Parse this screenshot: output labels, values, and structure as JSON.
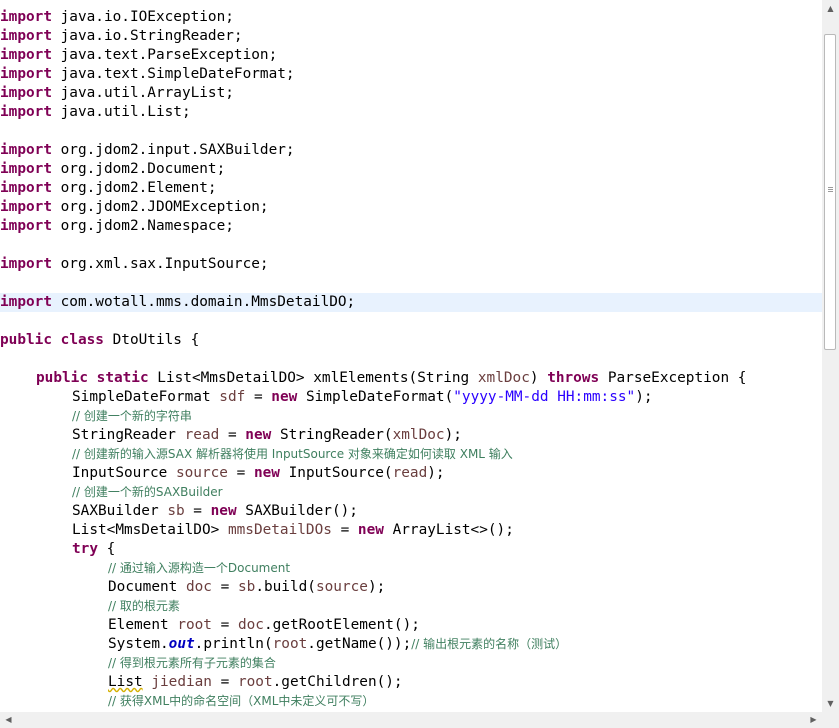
{
  "code": {
    "imports": [
      {
        "keyword": "import",
        "path": " java.io.IOException;"
      },
      {
        "keyword": "import",
        "path": " java.io.StringReader;"
      },
      {
        "keyword": "import",
        "path": " java.text.ParseException;"
      },
      {
        "keyword": "import",
        "path": " java.text.SimpleDateFormat;"
      },
      {
        "keyword": "import",
        "path": " java.util.ArrayList;"
      },
      {
        "keyword": "import",
        "path": " java.util.List;"
      },
      {
        "keyword": "import",
        "path": " org.jdom2.input.SAXBuilder;"
      },
      {
        "keyword": "import",
        "path": " org.jdom2.Document;"
      },
      {
        "keyword": "import",
        "path": " org.jdom2.Element;"
      },
      {
        "keyword": "import",
        "path": " org.jdom2.JDOMException;"
      },
      {
        "keyword": "import",
        "path": " org.jdom2.Namespace;"
      },
      {
        "keyword": "import",
        "path": " org.xml.sax.InputSource;"
      },
      {
        "keyword": "import",
        "path": " com.wotall.mms.domain.MmsDetailDO;"
      }
    ],
    "class_decl": {
      "kw1": "public",
      "kw2": "class",
      "name": " DtoUtils {"
    },
    "method_decl": {
      "kw1": "public",
      "kw2": "static",
      "before_param": " List<MmsDetailDO> xmlElements(String ",
      "param": "xmlDoc",
      "after_param": ") ",
      "kw3": "throws",
      "tail": " ParseException {"
    },
    "l_sdf": {
      "type": "SimpleDateFormat ",
      "var": "sdf",
      "eq": " = ",
      "kw": "new",
      "ctor": " SimpleDateFormat(",
      "str": "\"yyyy-MM-dd HH:mm:ss\"",
      "end": ");"
    },
    "c1": "// 创建一个新的字符串",
    "l_read": {
      "type": "StringReader ",
      "var": "read",
      "eq": " = ",
      "kw": "new",
      "ctor": " StringReader(",
      "arg": "xmlDoc",
      "end": ");"
    },
    "c2": "// 创建新的输入源SAX 解析器将使用 InputSource 对象来确定如何读取 XML 输入",
    "l_source": {
      "type": "InputSource ",
      "var": "source",
      "eq": " = ",
      "kw": "new",
      "ctor": " InputSource(",
      "arg": "read",
      "end": ");"
    },
    "c3": "// 创建一个新的SAXBuilder",
    "l_sb": {
      "type": "SAXBuilder ",
      "var": "sb",
      "eq": " = ",
      "kw": "new",
      "ctor": " SAXBuilder();"
    },
    "l_list": {
      "type": "List<MmsDetailDO> ",
      "var": "mmsDetailDOs",
      "eq": " = ",
      "kw": "new",
      "ctor": " ArrayList<>();"
    },
    "l_try": {
      "kw": "try",
      "end": " {"
    },
    "c4": "// 通过输入源构造一个Document",
    "l_doc": {
      "type": "Document ",
      "var": "doc",
      "eq": " = ",
      "obj": "sb",
      "call": ".build(",
      "arg": "source",
      "end": ");"
    },
    "c5": "// 取的根元素",
    "l_root": {
      "type": "Element ",
      "var": "root",
      "eq": " = ",
      "obj": "doc",
      "call": ".getRootElement();"
    },
    "l_print": {
      "cls": "System.",
      "field": "out",
      "call": ".println(",
      "obj": "root",
      "call2": ".getName());",
      "comment": "// 输出根元素的名称（测试）"
    },
    "c6": "// 得到根元素所有子元素的集合",
    "l_children": {
      "type": "List",
      "sp": " ",
      "var": "jiedian",
      "eq": " = ",
      "obj": "root",
      "call": ".getChildren();"
    },
    "c7": "// 获得XML中的命名空间（XML中未定义可不写）"
  },
  "colors": {
    "keyword": "#7f0055",
    "local_var": "#6a3e3e",
    "string": "#2a00ff",
    "comment": "#3f7f5f",
    "static_field": "#0000c0",
    "current_line": "#e8f2fe"
  },
  "scrollbars": {
    "up_icon": "▲",
    "down_icon": "▼",
    "left_icon": "◀",
    "right_icon": "▶",
    "grip_icon": "≡"
  }
}
